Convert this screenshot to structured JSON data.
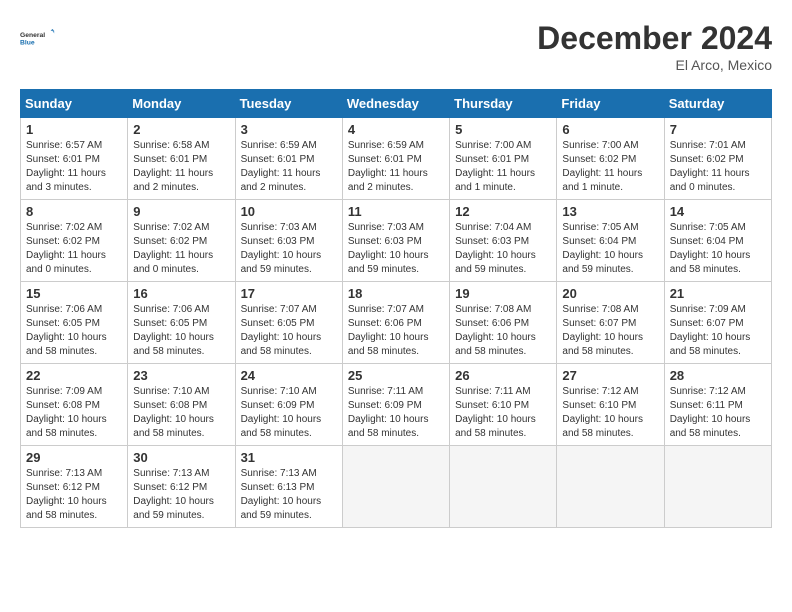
{
  "header": {
    "logo_line1": "General",
    "logo_line2": "Blue",
    "month": "December 2024",
    "location": "El Arco, Mexico"
  },
  "days_of_week": [
    "Sunday",
    "Monday",
    "Tuesday",
    "Wednesday",
    "Thursday",
    "Friday",
    "Saturday"
  ],
  "weeks": [
    [
      {
        "day": 1,
        "info": "Sunrise: 6:57 AM\nSunset: 6:01 PM\nDaylight: 11 hours\nand 3 minutes."
      },
      {
        "day": 2,
        "info": "Sunrise: 6:58 AM\nSunset: 6:01 PM\nDaylight: 11 hours\nand 2 minutes."
      },
      {
        "day": 3,
        "info": "Sunrise: 6:59 AM\nSunset: 6:01 PM\nDaylight: 11 hours\nand 2 minutes."
      },
      {
        "day": 4,
        "info": "Sunrise: 6:59 AM\nSunset: 6:01 PM\nDaylight: 11 hours\nand 2 minutes."
      },
      {
        "day": 5,
        "info": "Sunrise: 7:00 AM\nSunset: 6:01 PM\nDaylight: 11 hours\nand 1 minute."
      },
      {
        "day": 6,
        "info": "Sunrise: 7:00 AM\nSunset: 6:02 PM\nDaylight: 11 hours\nand 1 minute."
      },
      {
        "day": 7,
        "info": "Sunrise: 7:01 AM\nSunset: 6:02 PM\nDaylight: 11 hours\nand 0 minutes."
      }
    ],
    [
      {
        "day": 8,
        "info": "Sunrise: 7:02 AM\nSunset: 6:02 PM\nDaylight: 11 hours\nand 0 minutes."
      },
      {
        "day": 9,
        "info": "Sunrise: 7:02 AM\nSunset: 6:02 PM\nDaylight: 11 hours\nand 0 minutes."
      },
      {
        "day": 10,
        "info": "Sunrise: 7:03 AM\nSunset: 6:03 PM\nDaylight: 10 hours\nand 59 minutes."
      },
      {
        "day": 11,
        "info": "Sunrise: 7:03 AM\nSunset: 6:03 PM\nDaylight: 10 hours\nand 59 minutes."
      },
      {
        "day": 12,
        "info": "Sunrise: 7:04 AM\nSunset: 6:03 PM\nDaylight: 10 hours\nand 59 minutes."
      },
      {
        "day": 13,
        "info": "Sunrise: 7:05 AM\nSunset: 6:04 PM\nDaylight: 10 hours\nand 59 minutes."
      },
      {
        "day": 14,
        "info": "Sunrise: 7:05 AM\nSunset: 6:04 PM\nDaylight: 10 hours\nand 58 minutes."
      }
    ],
    [
      {
        "day": 15,
        "info": "Sunrise: 7:06 AM\nSunset: 6:05 PM\nDaylight: 10 hours\nand 58 minutes."
      },
      {
        "day": 16,
        "info": "Sunrise: 7:06 AM\nSunset: 6:05 PM\nDaylight: 10 hours\nand 58 minutes."
      },
      {
        "day": 17,
        "info": "Sunrise: 7:07 AM\nSunset: 6:05 PM\nDaylight: 10 hours\nand 58 minutes."
      },
      {
        "day": 18,
        "info": "Sunrise: 7:07 AM\nSunset: 6:06 PM\nDaylight: 10 hours\nand 58 minutes."
      },
      {
        "day": 19,
        "info": "Sunrise: 7:08 AM\nSunset: 6:06 PM\nDaylight: 10 hours\nand 58 minutes."
      },
      {
        "day": 20,
        "info": "Sunrise: 7:08 AM\nSunset: 6:07 PM\nDaylight: 10 hours\nand 58 minutes."
      },
      {
        "day": 21,
        "info": "Sunrise: 7:09 AM\nSunset: 6:07 PM\nDaylight: 10 hours\nand 58 minutes."
      }
    ],
    [
      {
        "day": 22,
        "info": "Sunrise: 7:09 AM\nSunset: 6:08 PM\nDaylight: 10 hours\nand 58 minutes."
      },
      {
        "day": 23,
        "info": "Sunrise: 7:10 AM\nSunset: 6:08 PM\nDaylight: 10 hours\nand 58 minutes."
      },
      {
        "day": 24,
        "info": "Sunrise: 7:10 AM\nSunset: 6:09 PM\nDaylight: 10 hours\nand 58 minutes."
      },
      {
        "day": 25,
        "info": "Sunrise: 7:11 AM\nSunset: 6:09 PM\nDaylight: 10 hours\nand 58 minutes."
      },
      {
        "day": 26,
        "info": "Sunrise: 7:11 AM\nSunset: 6:10 PM\nDaylight: 10 hours\nand 58 minutes."
      },
      {
        "day": 27,
        "info": "Sunrise: 7:12 AM\nSunset: 6:10 PM\nDaylight: 10 hours\nand 58 minutes."
      },
      {
        "day": 28,
        "info": "Sunrise: 7:12 AM\nSunset: 6:11 PM\nDaylight: 10 hours\nand 58 minutes."
      }
    ],
    [
      {
        "day": 29,
        "info": "Sunrise: 7:13 AM\nSunset: 6:12 PM\nDaylight: 10 hours\nand 58 minutes."
      },
      {
        "day": 30,
        "info": "Sunrise: 7:13 AM\nSunset: 6:12 PM\nDaylight: 10 hours\nand 59 minutes."
      },
      {
        "day": 31,
        "info": "Sunrise: 7:13 AM\nSunset: 6:13 PM\nDaylight: 10 hours\nand 59 minutes."
      },
      {
        "day": null,
        "info": ""
      },
      {
        "day": null,
        "info": ""
      },
      {
        "day": null,
        "info": ""
      },
      {
        "day": null,
        "info": ""
      }
    ]
  ]
}
